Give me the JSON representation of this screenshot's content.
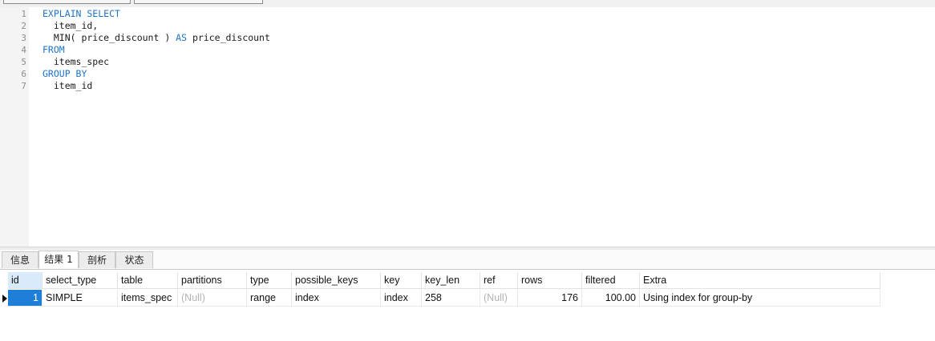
{
  "editor": {
    "line_numbers": [
      "1",
      "2",
      "3",
      "4",
      "5",
      "6",
      "7"
    ],
    "lines": [
      {
        "kw": "EXPLAIN SELECT",
        "text": ""
      },
      {
        "kw": "",
        "text": "  item_id,"
      },
      {
        "kw": "",
        "text": "  MIN( price_discount ) ",
        "kw2": "AS",
        "text2": " price_discount"
      },
      {
        "kw": "FROM",
        "text": ""
      },
      {
        "kw": "",
        "text": "  items_spec"
      },
      {
        "kw": "GROUP BY",
        "text": ""
      },
      {
        "kw": "",
        "text": "  item_id"
      }
    ]
  },
  "tabs": [
    {
      "label": "信息",
      "active": false
    },
    {
      "label": "结果 1",
      "active": true
    },
    {
      "label": "剖析",
      "active": false
    },
    {
      "label": "状态",
      "active": false
    }
  ],
  "result": {
    "columns": [
      "id",
      "select_type",
      "table",
      "partitions",
      "type",
      "possible_keys",
      "key",
      "key_len",
      "ref",
      "rows",
      "filtered",
      "Extra"
    ],
    "row": {
      "id": "1",
      "select_type": "SIMPLE",
      "table": "items_spec",
      "partitions": "(Null)",
      "type": "range",
      "possible_keys": "index",
      "key": "index",
      "key_len": "258",
      "ref": "(Null)",
      "rows": "176",
      "filtered": "100.00",
      "Extra": "Using index for group-by"
    }
  },
  "colors": {
    "keyword": "#1e73c8",
    "selection": "#1f7fd6",
    "null_text": "#b3b3b3"
  }
}
